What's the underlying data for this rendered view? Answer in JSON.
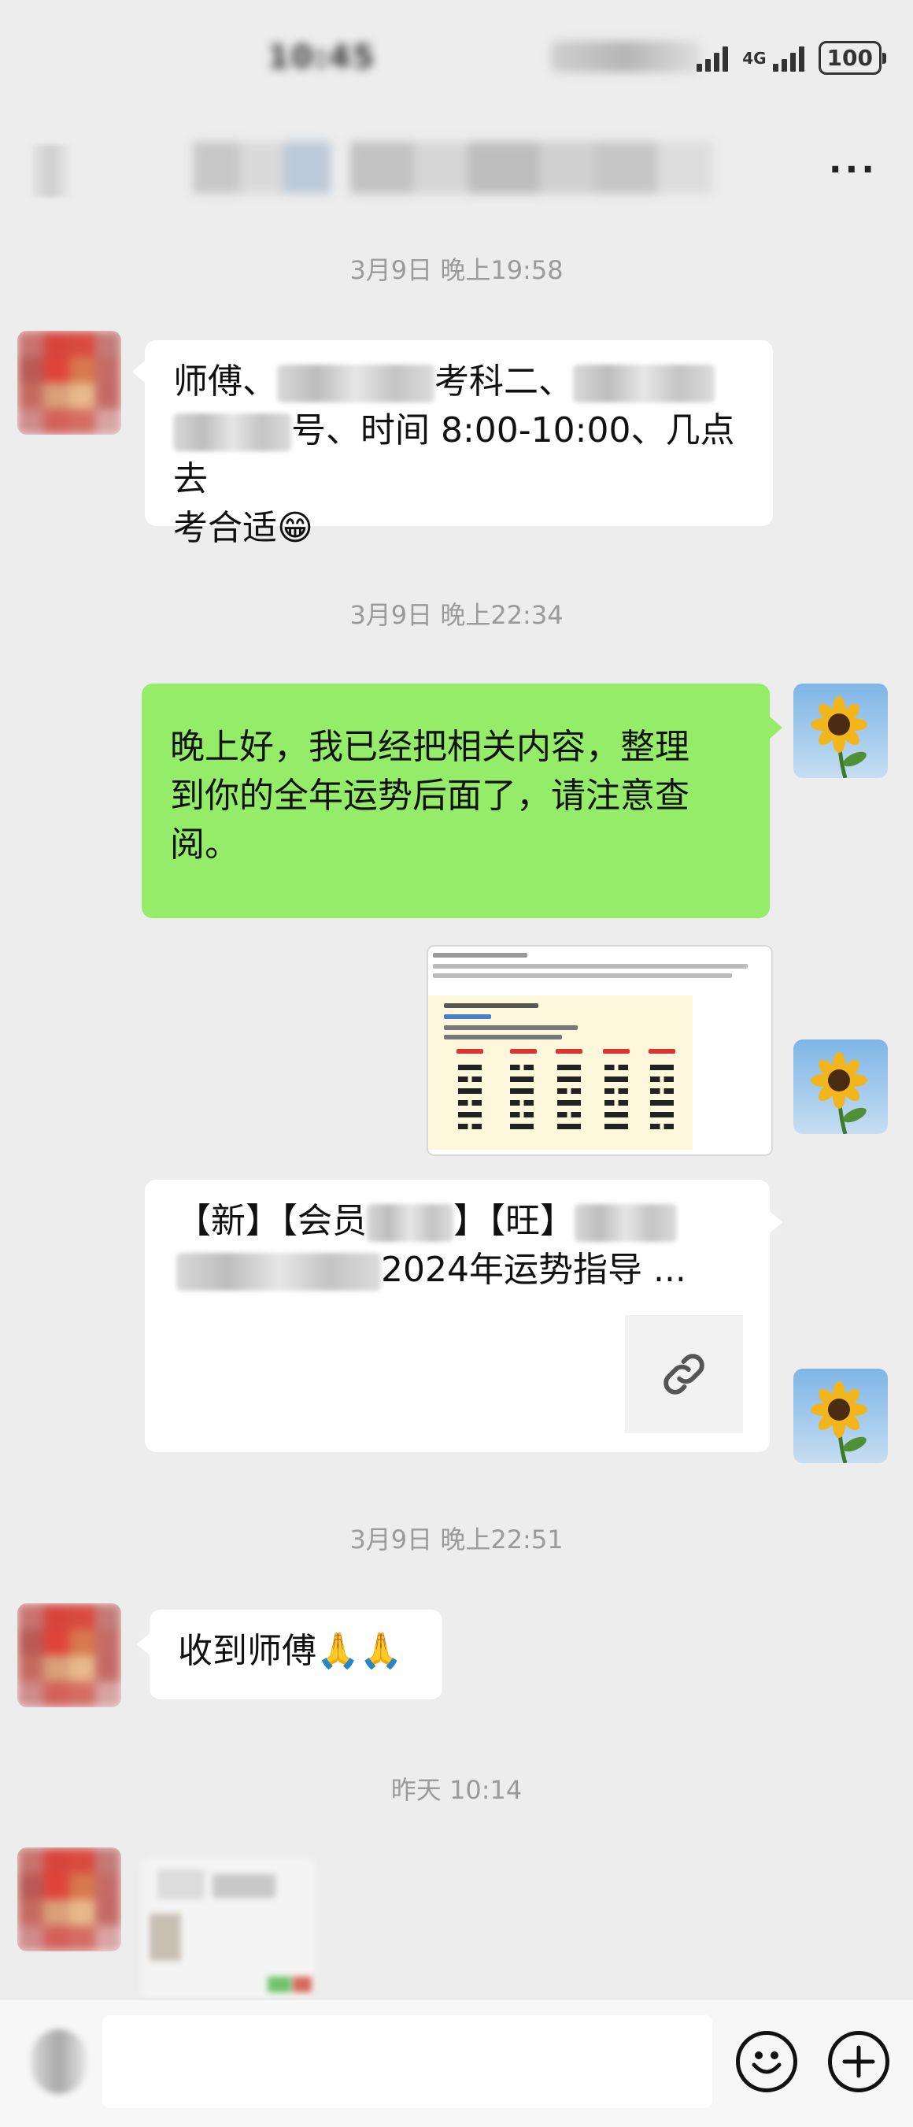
{
  "status_bar": {
    "time": "10:45",
    "network": "4G",
    "battery": "100"
  },
  "header": {
    "more_label": "···"
  },
  "messages": [
    {
      "type": "timestamp",
      "text": "3月9日 晚上19:58"
    },
    {
      "type": "incoming_text",
      "line1_start": "师傅、",
      "line1_mid": "考科二、",
      "line2_end": "号、时间 8:00-10:00、几点去",
      "line3": "考合适😁"
    },
    {
      "type": "timestamp",
      "text": "3月9日 晚上22:34"
    },
    {
      "type": "outgoing_text",
      "lines": [
        "晚上好，我已经把相关内容，整理",
        "到你的全年运势后面了，请注意查",
        "阅。"
      ]
    },
    {
      "type": "outgoing_image"
    },
    {
      "type": "outgoing_link",
      "title_line1_a": "【新】【会员",
      "title_line1_b": "】【旺】",
      "title_line2": "2024年运势指导 ..."
    },
    {
      "type": "timestamp",
      "text": "3月9日 晚上22:51"
    },
    {
      "type": "incoming_text_short",
      "text": "收到师傅🙏🙏"
    },
    {
      "type": "timestamp",
      "text": "昨天 10:14"
    },
    {
      "type": "incoming_blurred"
    }
  ],
  "colors": {
    "background": "#ededed",
    "outgoing_bubble": "#95ec69",
    "incoming_bubble": "#ffffff",
    "timestamp_text": "#9a9a9a"
  },
  "icons": {
    "more": "more-dots-icon",
    "link": "link-icon",
    "emoji": "emoji-icon",
    "plus": "plus-icon",
    "voice": "voice-toggle-icon"
  }
}
